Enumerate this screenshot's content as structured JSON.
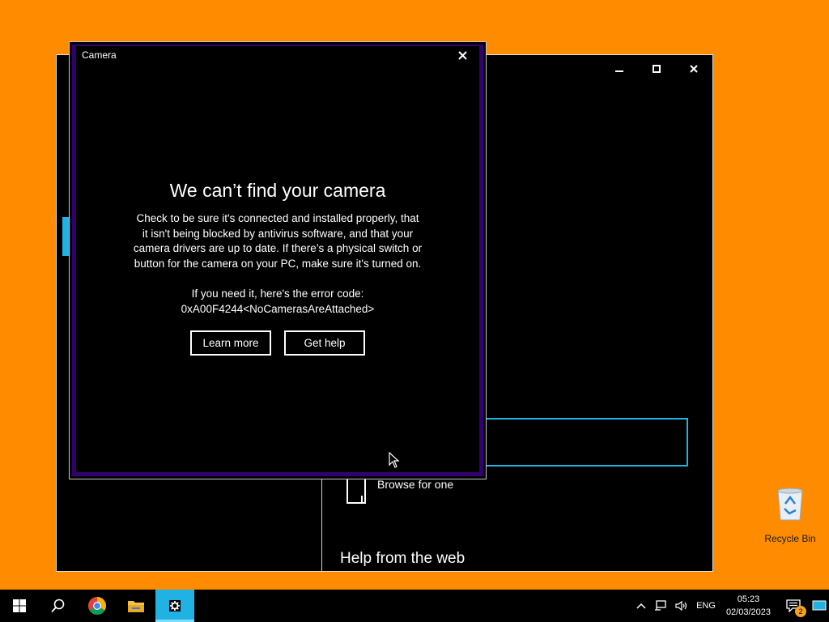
{
  "background_window": {
    "minimize_glyph": "–",
    "maximize_glyph": "☐",
    "close_glyph": "✕",
    "browse_label": "Browse for one",
    "help_title": "Help from the web"
  },
  "camera_dialog": {
    "title": "Camera",
    "close_glyph": "✕",
    "heading": "We can’t find your camera",
    "body_lines": [
      "Check to be sure it's connected and installed properly, that",
      "it isn't being blocked by antivirus software, and that your",
      "camera drivers are up to date. If there’s a physical switch or",
      "button for the camera on your PC, make sure it's turned on."
    ],
    "error_intro": "If you need it, here's the error code:",
    "error_code": "0xA00F4244<NoCamerasAreAttached>",
    "learn_more_label": "Learn more",
    "get_help_label": "Get help"
  },
  "desktop": {
    "recycle_bin_label": "Recycle Bin"
  },
  "taskbar": {
    "pinned": [
      {
        "name": "start-button",
        "icon": "windows-logo-icon"
      },
      {
        "name": "search-button",
        "icon": "search-icon"
      },
      {
        "name": "chrome-button",
        "icon": "chrome-icon"
      },
      {
        "name": "file-explorer-button",
        "icon": "folder-icon"
      },
      {
        "name": "settings-button",
        "icon": "gear-icon",
        "active": true
      }
    ],
    "tray": {
      "language": "ENG",
      "time": "05:23",
      "date": "02/03/2023",
      "notification_count": "2"
    }
  },
  "colors": {
    "desktop_bg": "#FF8C00",
    "accent": "#1FB2E3",
    "dialog_border": "#32006E"
  }
}
